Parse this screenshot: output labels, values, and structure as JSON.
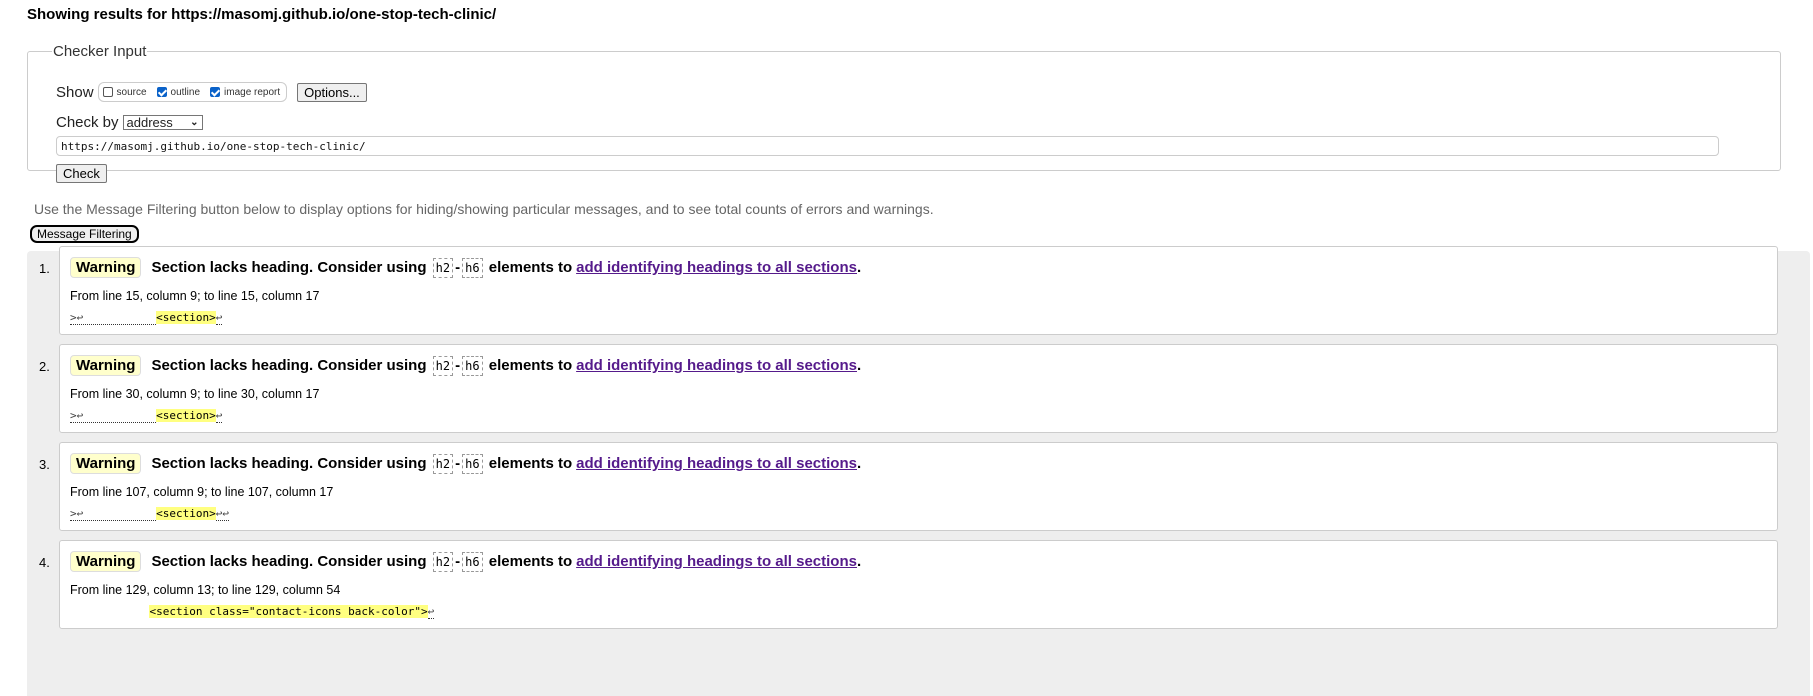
{
  "heading": "Showing results for https://masomj.github.io/one-stop-tech-clinic/",
  "checker": {
    "legend": "Checker Input",
    "show_label": "Show",
    "options": [
      {
        "label": "source",
        "checked": false
      },
      {
        "label": "outline",
        "checked": true
      },
      {
        "label": "image report",
        "checked": true
      }
    ],
    "options_button": "Options...",
    "check_by_label": "Check by",
    "check_by_value": "address",
    "url": "https://masomj.github.io/one-stop-tech-clinic/",
    "check_button": "Check"
  },
  "info": "Use the Message Filtering button below to display options for hiding/showing particular messages, and to see total counts of errors and warnings.",
  "filter_button": "Message Filtering",
  "messages": [
    {
      "num": "1.",
      "type": "Warning",
      "text": "Section lacks heading. Consider using",
      "code1": "h2",
      "dash": "-",
      "code2": "h6",
      "text2": "elements to",
      "link": "add identifying headings to all sections",
      "period": ".",
      "location": "From line 15, column 9; to line 15, column 17",
      "pre": ">↩           ",
      "hl": "<section>",
      "post": "↩"
    },
    {
      "num": "2.",
      "type": "Warning",
      "text": "Section lacks heading. Consider using",
      "code1": "h2",
      "dash": "-",
      "code2": "h6",
      "text2": "elements to",
      "link": "add identifying headings to all sections",
      "period": ".",
      "location": "From line 30, column 9; to line 30, column 17",
      "pre": ">↩           ",
      "hl": "<section>",
      "post": "↩"
    },
    {
      "num": "3.",
      "type": "Warning",
      "text": "Section lacks heading. Consider using",
      "code1": "h2",
      "dash": "-",
      "code2": "h6",
      "text2": "elements to",
      "link": "add identifying headings to all sections",
      "period": ".",
      "location": "From line 107, column 9; to line 107, column 17",
      "pre": ">↩           ",
      "hl": "<section>",
      "post": "↩↩"
    },
    {
      "num": "4.",
      "type": "Warning",
      "text": "Section lacks heading. Consider using",
      "code1": "h2",
      "dash": "-",
      "code2": "h6",
      "text2": "elements to",
      "link": "add identifying headings to all sections",
      "period": ".",
      "location": "From line 129, column 13; to line 129, column 54",
      "pre": "            ",
      "hl": "<section class=\"contact-icons back-color\">",
      "post": "↩"
    }
  ]
}
